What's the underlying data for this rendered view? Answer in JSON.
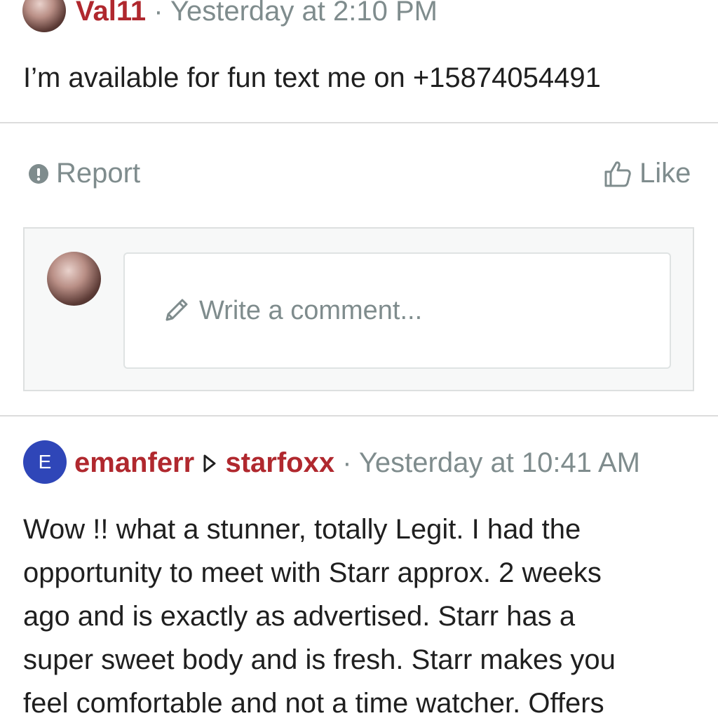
{
  "post": {
    "author": "Val11",
    "separator": "·",
    "timestamp": "Yesterday at 2:10 PM",
    "body": "I’m available for fun text me on +15874054491"
  },
  "actions": {
    "report_label": "Report",
    "like_label": "Like"
  },
  "comment_composer": {
    "placeholder": "Write a comment..."
  },
  "reply": {
    "avatar_letter": "E",
    "author": "emanferr",
    "recipient": "starfoxx",
    "separator": "·",
    "timestamp": "Yesterday at 10:41 AM",
    "body_lines": [
      "Wow !! what a stunner, totally Legit. I had the",
      "opportunity to meet with Starr approx. 2 weeks",
      "ago and is exactly as advertised. Starr has a",
      "super sweet body and is fresh. Starr makes you",
      "feel comfortable and not a time watcher. Offers"
    ]
  },
  "colors": {
    "username": "#b0282e",
    "meta": "#7f8c8d",
    "avatar_letter_bg": "#2f46b8"
  }
}
